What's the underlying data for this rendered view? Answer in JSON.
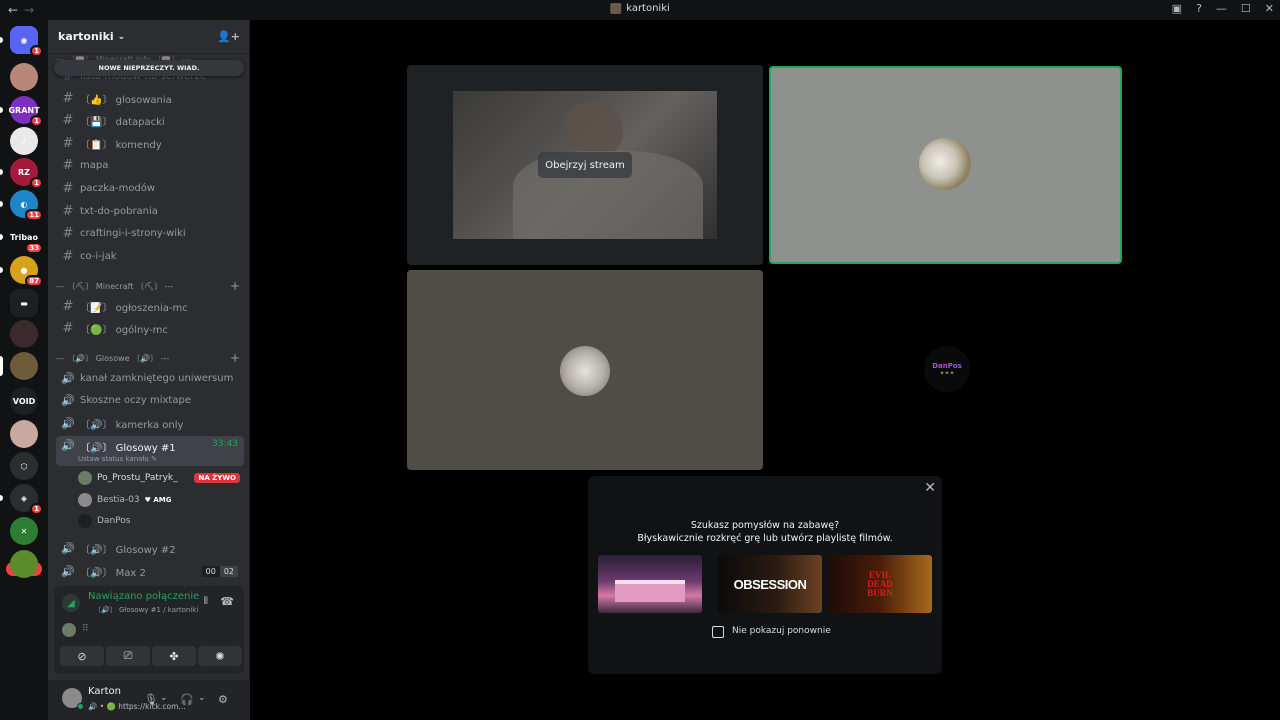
{
  "window": {
    "title": "kartoniki",
    "nav_back": "←",
    "nav_forward": "→"
  },
  "rail": {
    "servers": [
      {
        "name": "discord-home",
        "badge": "1",
        "color": "#5865f2",
        "label": "◉"
      },
      {
        "name": "server-avatar",
        "badge": "",
        "color": "#b8877a",
        "label": ""
      },
      {
        "name": "server-grant",
        "badge": "1",
        "color": "#7d2fbf",
        "label": "GRANT"
      },
      {
        "name": "server-bp",
        "badge": "",
        "color": "#e9e9e9",
        "label": "♪"
      },
      {
        "name": "server-rzt",
        "badge": "1",
        "color": "#a31a3a",
        "label": "RZ"
      },
      {
        "name": "server-blue",
        "badge": "11",
        "color": "#1e86c8",
        "label": "◐"
      },
      {
        "name": "server-tribao",
        "badge": "33",
        "color": "#111214",
        "label": "Tribao"
      },
      {
        "name": "server-yellow",
        "badge": "87",
        "color": "#d9a21c",
        "label": "●"
      },
      {
        "name": "folder",
        "badge": "",
        "color": "#1e1f22",
        "label": "▬"
      },
      {
        "name": "server-dark",
        "badge": "",
        "color": "#3a2a2e",
        "label": ""
      },
      {
        "name": "server-kartoniki",
        "badge": "",
        "color": "#6e5b3a",
        "label": ""
      },
      {
        "name": "server-void",
        "badge": "",
        "color": "#1e1f22",
        "label": "VOID"
      },
      {
        "name": "server-face",
        "badge": "",
        "color": "#c9a8a0",
        "label": ""
      },
      {
        "name": "server-cube",
        "badge": "",
        "color": "#2b2d31",
        "label": "⬡"
      },
      {
        "name": "server-discord2",
        "badge": "1",
        "color": "#2b2d31",
        "label": "◈"
      },
      {
        "name": "server-tools",
        "badge": "",
        "color": "#2e7d32",
        "label": "✕"
      },
      {
        "name": "server-minecraft",
        "badge": "",
        "color": "#5c8c2a",
        "label": ""
      }
    ],
    "new_label": "NOWE"
  },
  "sidebar": {
    "server_name": "kartoniki",
    "unread_pill": "NOWE NIEPRZECZYT. WIAD.",
    "top_category": "--- 〔📖〕 Minecraft info 〔📖〕 ---",
    "partial_channel": "lista-modów-na-serwerze",
    "channels_a": [
      "〔👍〕 glosowania",
      "〔💾〕 datapacki",
      "〔📋〕 komendy",
      "mapa",
      "paczka-modów",
      "txt-do-pobrania",
      "craftingi-i-strony-wiki",
      "co-i-jak"
    ],
    "category_mc": "--- 〔⛏〕 Minecraft 〔⛏〕 ---",
    "channels_mc": [
      "〔📝〕 ogłoszenia-mc",
      "〔🟢〕 ogólny-mc"
    ],
    "category_voice": "--- 〔🔊〕 Glosowe 〔🔊〕 ---",
    "voice_channels": [
      "kanał zamkniętego uniwersum",
      "Skoszne oczy mixtape",
      "〔🔊〕 kamerka only"
    ],
    "active_voice": {
      "label": "〔🔊〕 Glosowy #1",
      "timer": "33:43",
      "status_hint": "Ustaw status kanału ✎"
    },
    "members": [
      {
        "name": "Po_Prostu_Patryk_",
        "live": "NA ŻYWO",
        "tag": ""
      },
      {
        "name": "Bestia-03",
        "live": "",
        "tag": "♥ AMG"
      },
      {
        "name": "DanPos",
        "live": "",
        "tag": ""
      }
    ],
    "more_voice": [
      {
        "label": "〔🔊〕 Glosowy #2",
        "count_a": "",
        "count_b": ""
      },
      {
        "label": "〔🔊〕 Max 2",
        "count_a": "00",
        "count_b": "02"
      }
    ],
    "voice_panel": {
      "status": "Nawiązano połączenie",
      "sub": "〔🔊〕 Głosowy #1 / kartoniki"
    },
    "user": {
      "name": "Karton",
      "status": "🔊 • 🟢 https://kick.com..."
    }
  },
  "stage": {
    "watch_stream": "Obejrzyj stream",
    "danpos_logo": "DanPos",
    "danpos_sub": "✦✦✦"
  },
  "activity_card": {
    "line1": "Szukasz pomysłów na zabawę?",
    "line2": "Błyskawicznie rozkręć grę lub utwórz playlistę filmów.",
    "poster2": "OBSESSION",
    "poster3a": "EVIL",
    "poster3b": "DEAD",
    "poster3c": "BURN",
    "checkbox_label": "Nie pokazuj ponownie",
    "close": "✕"
  },
  "colors": {
    "accent_green": "#23a55a",
    "live_red": "#da373c",
    "badge_red": "#f23f43"
  }
}
